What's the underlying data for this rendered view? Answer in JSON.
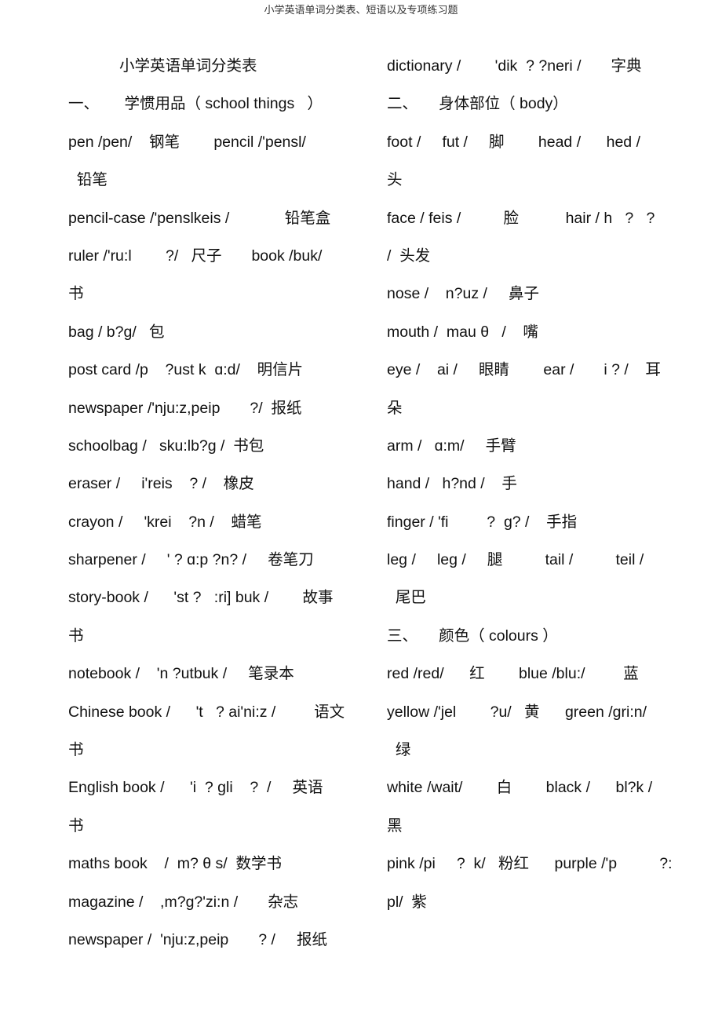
{
  "header": {
    "running_title": "小学英语单词分类表、短语以及专项练习题"
  },
  "left_column": {
    "lines": [
      "            小学英语单词分类表",
      "一、      学惯用品（ school things   ）",
      "pen /pen/    钢笔        pencil /'pensl/",
      "  铅笔",
      "pencil-case /'penslkeis /             铅笔盒",
      "ruler /'ru:l        ?/   尺子       book /buk/",
      "书",
      "bag / b?g/   包",
      "post card /p    ?ust k  ɑ:d/    明信片",
      "newspaper /'nju:z,peip       ?/  报纸",
      "schoolbag /   sku:lb?g /  书包",
      "eraser /     i'reis    ? /    橡皮",
      "crayon /     'krei    ?n /    蜡笔",
      "sharpener /     ' ? ɑ:p ?n? /     卷笔刀",
      "story-book /      'st ?   :ri] buk /        故事",
      "书",
      "notebook /    'n ?utbuk /     笔录本",
      "Chinese book /      't   ? ai'ni:z /         语文",
      "书",
      "English book /      'i  ? gli    ?  /     英语",
      "书",
      "maths book    /  m? θ s/  数学书",
      "magazine /    ,m?g?'zi:n /       杂志",
      "newspaper /  'nju:z,peip       ? /     报纸"
    ]
  },
  "right_column": {
    "lines": [
      "dictionary /        'dik  ? ?neri /       字典",
      "二、     身体部位（ body）",
      "foot /     fut /     脚        head /      hed /",
      "头",
      "face / feis /          脸           hair / h   ?   ?",
      "/  头发",
      "nose /    n?uz /     鼻子",
      "mouth /  mau θ   /    嘴",
      "eye /    ai /     眼睛        ear /       i ? /    耳",
      "朵",
      "arm /   ɑ:m/     手臂",
      "hand /   h?nd /    手",
      "finger / 'fi         ?  g? /    手指",
      "leg /     leg /     腿          tail /          teil /",
      "  尾巴",
      "三、     颜色（ colours ）",
      "red /red/      红        blue /blu:/         蓝",
      "yellow /'jel        ?u/   黄      green /gri:n/",
      "  绿",
      "white /wait/        白        black /      bl?k /",
      "黑",
      "pink /pi     ?  k/   粉红      purple /'p          ?:",
      "pl/  紫"
    ]
  }
}
